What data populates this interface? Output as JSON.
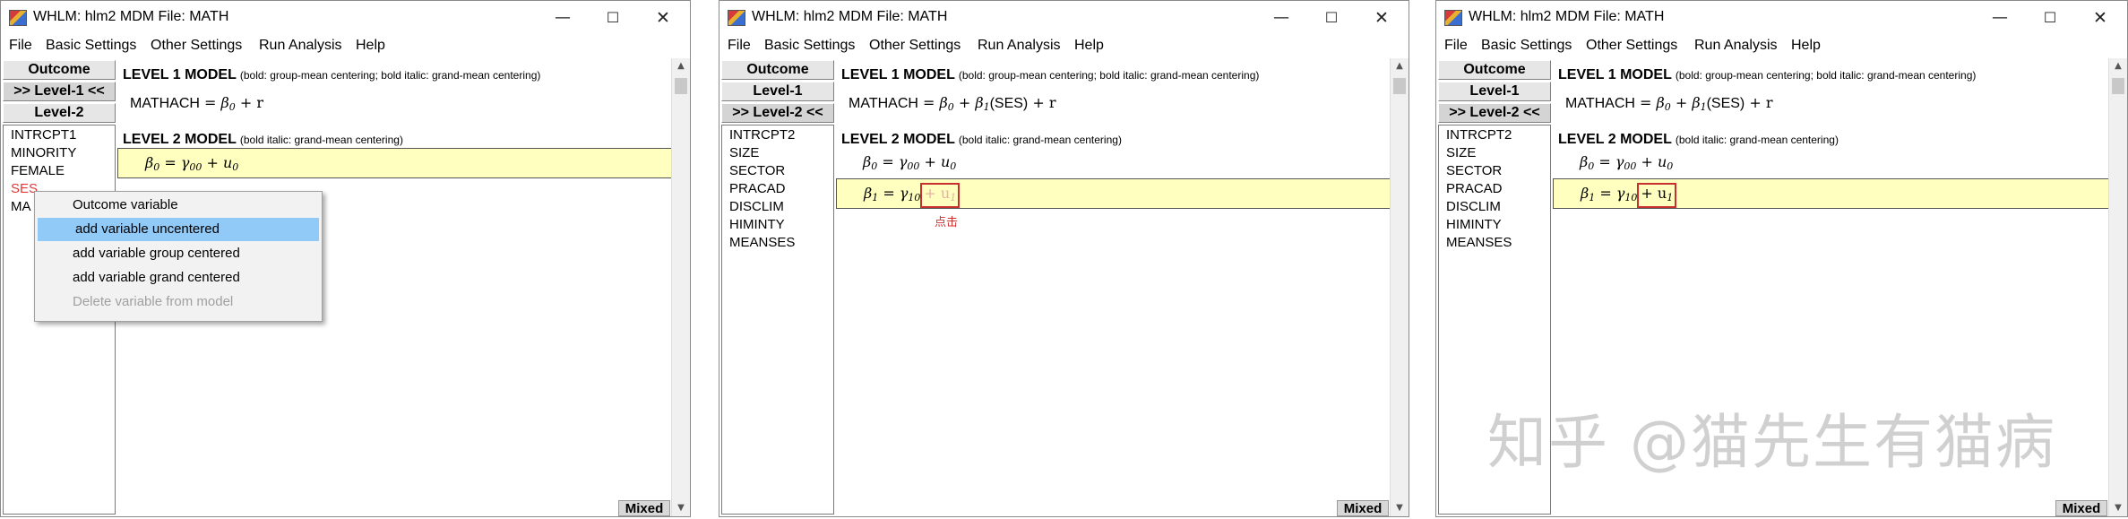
{
  "window_title": "WHLM: hlm2 MDM File: MATH",
  "controls": {
    "minimize": "—",
    "maximize": "☐",
    "close": "✕"
  },
  "menu": [
    "File",
    "Basic Settings",
    "Other Settings",
    "Run Analysis",
    "Help"
  ],
  "buttons": {
    "outcome": "Outcome",
    "level1": "Level-1",
    "level2": "Level-2",
    "level1_active": ">> Level-1 <<",
    "level2_active": ">> Level-2 <<"
  },
  "headings": {
    "level1": "LEVEL 1 MODEL",
    "level1_note": "(bold: group-mean centering; bold italic: grand-mean centering)",
    "level2": "LEVEL 2 MODEL",
    "level2_note": "(bold italic: grand-mean centering)"
  },
  "status": "Mixed",
  "panel1": {
    "variables": [
      "INTRCPT1",
      "MINORITY",
      "FEMALE",
      "SES",
      "MA"
    ],
    "selected_variable": "SES",
    "level1_eq": {
      "lhs": "MATHACH",
      "rhs_b0": "β",
      "b0_sub": "0",
      "rhs_r": "+ r"
    },
    "level2_eq": {
      "b": "β",
      "b_sub": "0",
      "g": "γ",
      "g_sub": "00",
      "plus": "+",
      "u": "u",
      "u_sub": "0"
    },
    "context_menu": [
      {
        "label": "Outcome variable",
        "state": "normal"
      },
      {
        "label": "add variable uncentered",
        "state": "selected"
      },
      {
        "label": "add variable group centered",
        "state": "normal"
      },
      {
        "label": "add variable grand centered",
        "state": "normal"
      },
      {
        "label": "Delete variable from model",
        "state": "disabled"
      }
    ]
  },
  "panel2": {
    "variables": [
      "INTRCPT2",
      "SIZE",
      "SECTOR",
      "PRACAD",
      "DISCLIM",
      "HIMINTY",
      "MEANSES"
    ],
    "level1_eq": {
      "lhs": "MATHACH",
      "b0": "β",
      "b0_sub": "0",
      "b1": "β",
      "b1_sub": "1",
      "ses": "(SES)",
      "r": "+ r"
    },
    "level2_eq0": {
      "b": "β",
      "b_sub": "0",
      "g": "γ",
      "g_sub": "00",
      "u": "u",
      "u_sub": "0"
    },
    "level2_eq1": {
      "b": "β",
      "b_sub": "1",
      "g": "γ",
      "g_sub": "10",
      "u_box": "+ u",
      "u_sub": "1"
    },
    "click_note": "点击"
  },
  "panel3": {
    "variables": [
      "INTRCPT2",
      "SIZE",
      "SECTOR",
      "PRACAD",
      "DISCLIM",
      "HIMINTY",
      "MEANSES"
    ],
    "level1_eq": {
      "lhs": "MATHACH",
      "b0": "β",
      "b0_sub": "0",
      "b1": "β",
      "b1_sub": "1",
      "ses": "(SES)",
      "r": "+ r"
    },
    "level2_eq0": {
      "b": "β",
      "b_sub": "0",
      "g": "γ",
      "g_sub": "00",
      "u": "u",
      "u_sub": "0"
    },
    "level2_eq1": {
      "b": "β",
      "b_sub": "1",
      "g": "γ",
      "g_sub": "10",
      "u_box": "+ u",
      "u_sub": "1"
    }
  },
  "watermark": "知乎 @猫先生有猫病",
  "colors": {
    "highlight": "#ffffc0",
    "selection": "#91c9f7",
    "annotation_red": "#c83030"
  }
}
